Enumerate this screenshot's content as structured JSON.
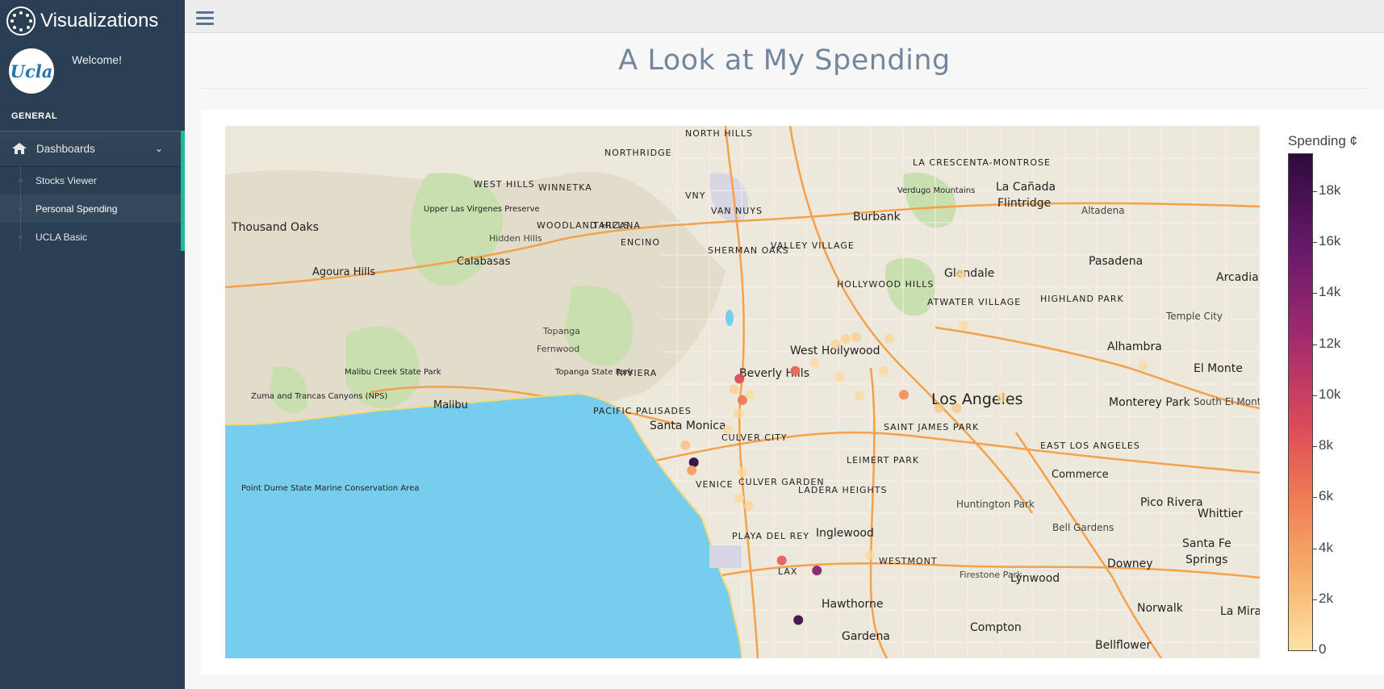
{
  "app": {
    "title": "Visualizations"
  },
  "profile": {
    "welcome": "Welcome!",
    "avatar_text": "Ucla"
  },
  "sidebar": {
    "section": "GENERAL",
    "parent": {
      "label": "Dashboards"
    },
    "items": [
      {
        "label": "Stocks Viewer"
      },
      {
        "label": "Personal Spending",
        "active": true
      },
      {
        "label": "UCLA Basic"
      }
    ]
  },
  "page": {
    "title": "A Look at My Spending"
  },
  "colorbar": {
    "title": "Spending ¢",
    "ticks": [
      "18k",
      "16k",
      "14k",
      "12k",
      "10k",
      "8k",
      "6k",
      "4k",
      "2k",
      "0"
    ],
    "colors": [
      "#2d0b3e",
      "#6a1a6a",
      "#a52c6d",
      "#dd4b5a",
      "#f07e54",
      "#f7b06d",
      "#fde3a4"
    ]
  },
  "map": {
    "labels": {
      "thousand_oaks": "Thousand Oaks",
      "agoura_hills": "Agoura Hills",
      "calabasas": "Calabasas",
      "malibu": "Malibu",
      "topanga": "Topanga",
      "fernwood": "Fernwood",
      "santa_monica": "Santa Monica",
      "beverly_hills": "Beverly Hills",
      "west_hollywood": "West Hollywood",
      "los_angeles": "Los Angeles",
      "burbank": "Burbank",
      "glendale": "Glendale",
      "pasadena": "Pasadena",
      "la_canada": "La Cañada",
      "flintridge": "Flintridge",
      "altadena": "Altadena",
      "arcadia": "Arcadia",
      "alhambra": "Alhambra",
      "temple_city": "Temple City",
      "el_monte": "El Monte",
      "monterey_park": "Monterey Park",
      "south_el_monte": "South El Monte",
      "commerce": "Commerce",
      "pico_rivera": "Pico Rivera",
      "whittier": "Whittier",
      "inglewood": "Inglewood",
      "hawthorne": "Hawthorne",
      "gardena": "Gardena",
      "compton": "Compton",
      "lynwood": "Lynwood",
      "downey": "Downey",
      "norwalk": "Norwalk",
      "bellflower": "Bellflower",
      "huntington_park": "Huntington Park",
      "bell_gardens": "Bell Gardens",
      "santa_fe_springs_1": "Santa Fe",
      "santa_fe_springs_2": "Springs",
      "la_mira": "La Mira",
      "culver_city": "CULVER CITY",
      "venice": "VENICE",
      "lax": "LAX",
      "northridge": "NORTHRIDGE",
      "winnetka": "WINNETKA",
      "west_hills": "WEST HILLS",
      "tarzana": "TARZANA",
      "encino": "ENCINO",
      "van_nuys": "VAN NUYS",
      "sherman_oaks": "SHERMAN OAKS",
      "woodland_hills": "WOODLAND HILLS",
      "north_hills": "NORTH HILLS",
      "hollywood_hills": "HOLLYWOOD HILLS",
      "atwater_village": "ATWATER VILLAGE",
      "highland_park": "HIGHLAND PARK",
      "east_los_angeles": "EAST LOS ANGELES",
      "leimert_park": "LEIMERT PARK",
      "ladera_heights": "LADERA HEIGHTS",
      "westmont": "WESTMONT",
      "playa_del_rey": "PLAYA DEL REY",
      "pacific_palisades": "PACIFIC PALISADES",
      "riviera": "RIVIERA",
      "valley_village": "VALLEY VILLAGE",
      "la_crescenta": "LA CRESCENTA-MONTROSE",
      "firestone_park": "Firestone Park",
      "hidden_hills": "Hidden Hills",
      "verdugo": "Verdugo Mountains",
      "upper_las_virgenes": "Upper Las Virgenes Preserve",
      "malibu_creek": "Malibu Creek State Park",
      "topanga_sp": "Topanga State Park",
      "zuma": "Zuma and Trancas Canyons (NPS)",
      "point_dume": "Point Dume State Marine Conservation Area",
      "vny": "VNY",
      "saint_james": "SAINT JAMES PARK",
      "culver_garden": "CULVER GARDEN"
    },
    "points": [
      {
        "lon": 0.453,
        "lat": 0.632,
        "value": 20000
      },
      {
        "lon": 0.451,
        "lat": 0.647,
        "value": 4500
      },
      {
        "lon": 0.445,
        "lat": 0.6,
        "value": 2500
      },
      {
        "lon": 0.497,
        "lat": 0.475,
        "value": 10000
      },
      {
        "lon": 0.5,
        "lat": 0.515,
        "value": 7000
      },
      {
        "lon": 0.492,
        "lat": 0.495,
        "value": 1500
      },
      {
        "lon": 0.551,
        "lat": 0.46,
        "value": 8000
      },
      {
        "lon": 0.538,
        "lat": 0.816,
        "value": 8500
      },
      {
        "lon": 0.572,
        "lat": 0.835,
        "value": 15000
      },
      {
        "lon": 0.554,
        "lat": 0.928,
        "value": 19000
      },
      {
        "lon": 0.656,
        "lat": 0.505,
        "value": 5500
      },
      {
        "lon": 0.61,
        "lat": 0.397,
        "value": 1500
      },
      {
        "lon": 0.6,
        "lat": 0.4,
        "value": 1200
      },
      {
        "lon": 0.59,
        "lat": 0.41,
        "value": 1000
      },
      {
        "lon": 0.642,
        "lat": 0.4,
        "value": 900
      },
      {
        "lon": 0.636,
        "lat": 0.46,
        "value": 800
      },
      {
        "lon": 0.69,
        "lat": 0.53,
        "value": 1800
      },
      {
        "lon": 0.707,
        "lat": 0.53,
        "value": 2000
      },
      {
        "lon": 0.714,
        "lat": 0.375,
        "value": 500
      },
      {
        "lon": 0.711,
        "lat": 0.278,
        "value": 700
      },
      {
        "lon": 0.751,
        "lat": 0.51,
        "value": 900
      },
      {
        "lon": 0.507,
        "lat": 0.505,
        "value": 600
      },
      {
        "lon": 0.496,
        "lat": 0.54,
        "value": 1000
      },
      {
        "lon": 0.486,
        "lat": 0.57,
        "value": 500
      },
      {
        "lon": 0.594,
        "lat": 0.472,
        "value": 700
      },
      {
        "lon": 0.57,
        "lat": 0.445,
        "value": 600
      },
      {
        "lon": 0.5,
        "lat": 0.65,
        "value": 800
      },
      {
        "lon": 0.497,
        "lat": 0.7,
        "value": 700
      },
      {
        "lon": 0.506,
        "lat": 0.714,
        "value": 1000
      },
      {
        "lon": 0.623,
        "lat": 0.806,
        "value": 600
      },
      {
        "lon": 0.887,
        "lat": 0.45,
        "value": 600
      },
      {
        "lon": 0.613,
        "lat": 0.507,
        "value": 500
      }
    ]
  }
}
